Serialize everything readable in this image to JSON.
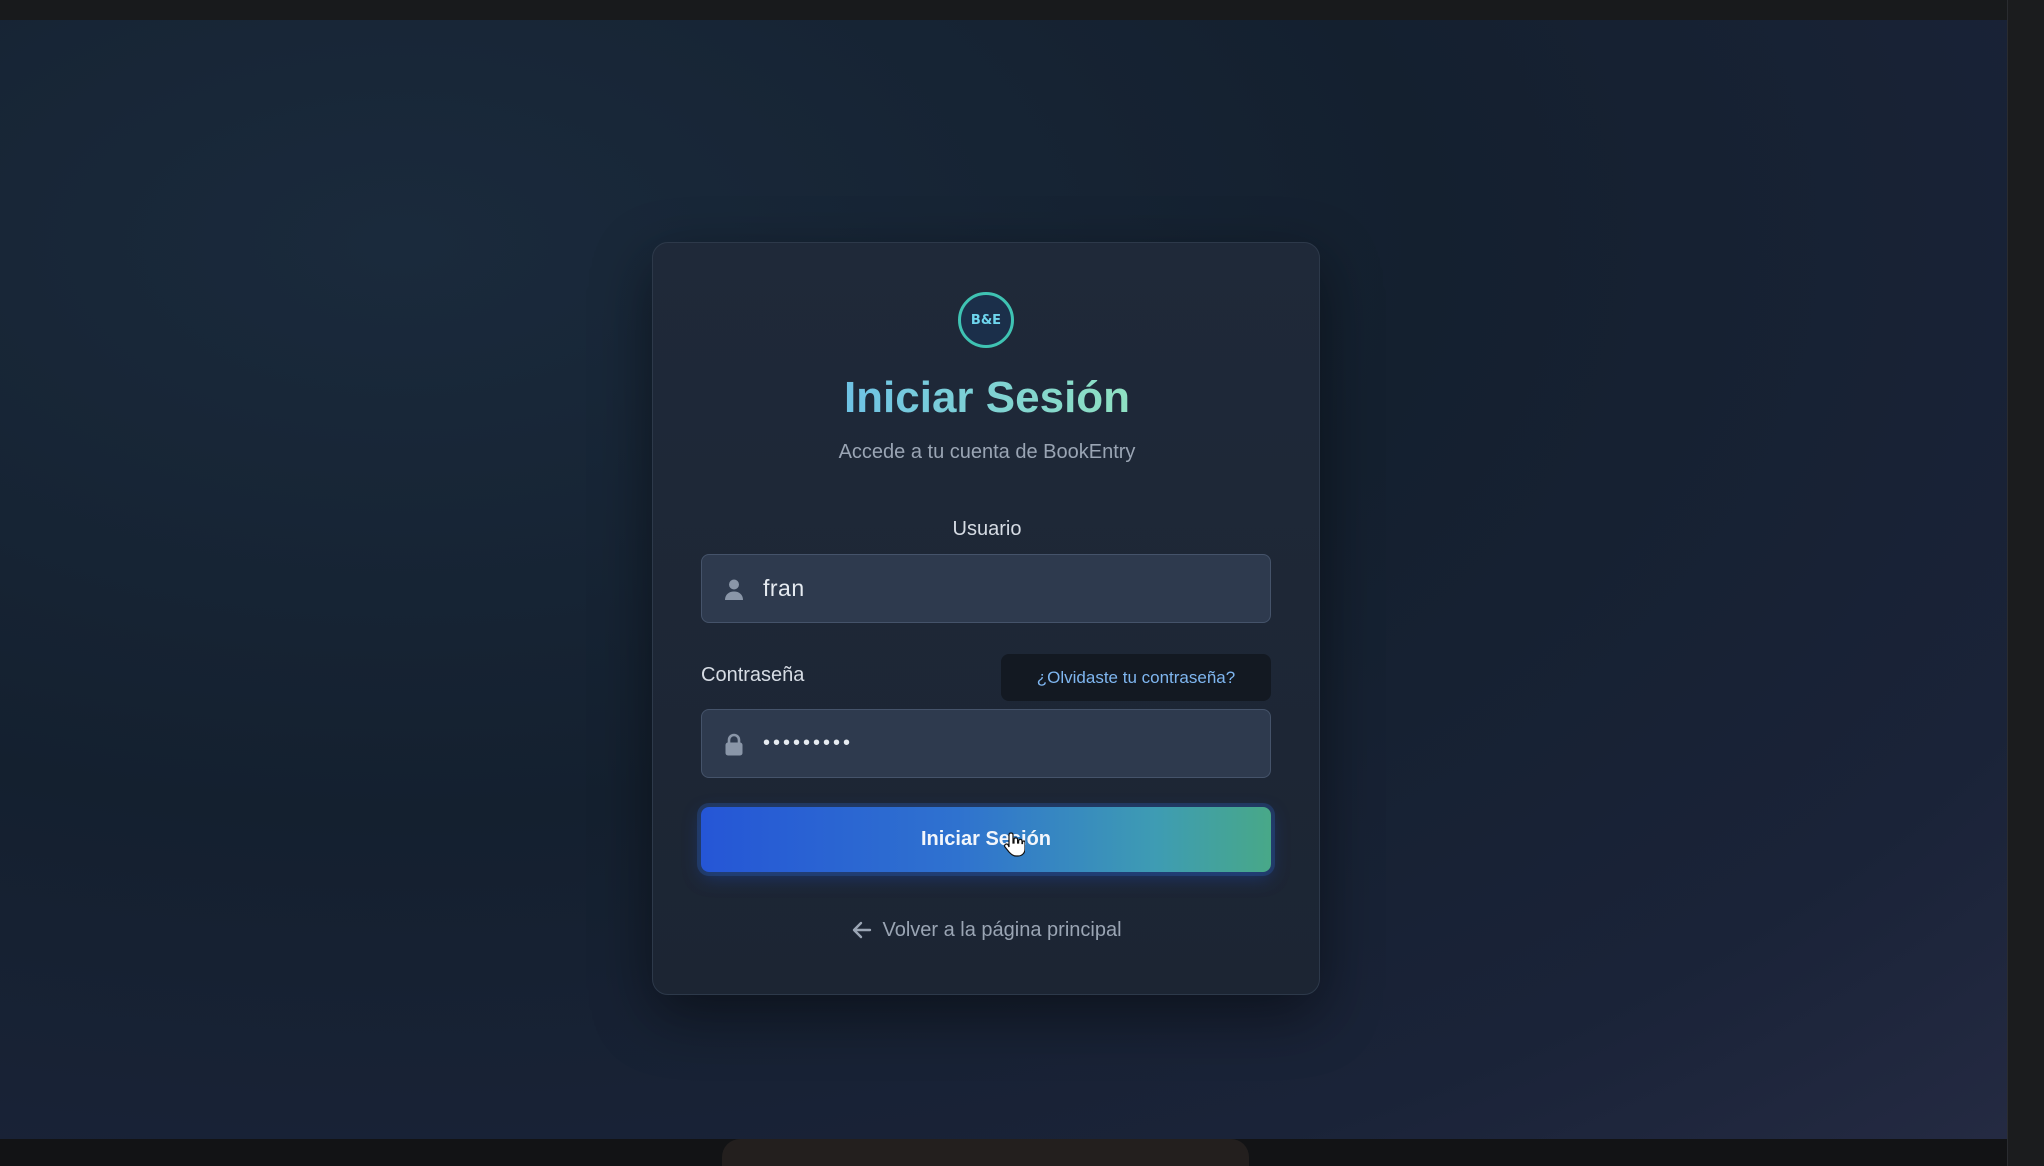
{
  "app": {
    "logo_text": "B&E",
    "colors": {
      "background": "#15202e",
      "card": "#1f2939",
      "accent_gradient_start": "#2556d6",
      "accent_gradient_end": "#48a888",
      "title_gradient": "#7ad6d8",
      "link": "#7fb6f0"
    }
  },
  "login": {
    "title": "Iniciar Sesión",
    "subtitle": "Accede a tu cuenta de BookEntry",
    "username_label": "Usuario",
    "username_value": "fran",
    "username_icon": "user-icon",
    "password_label": "Contraseña",
    "password_value": "•••••••••",
    "password_icon": "lock-icon",
    "forgot_link": "¿Olvidaste tu contraseña?",
    "submit_label": "Iniciar Sesión",
    "back_link": "Volver a la página principal",
    "back_icon": "arrow-left-icon"
  }
}
